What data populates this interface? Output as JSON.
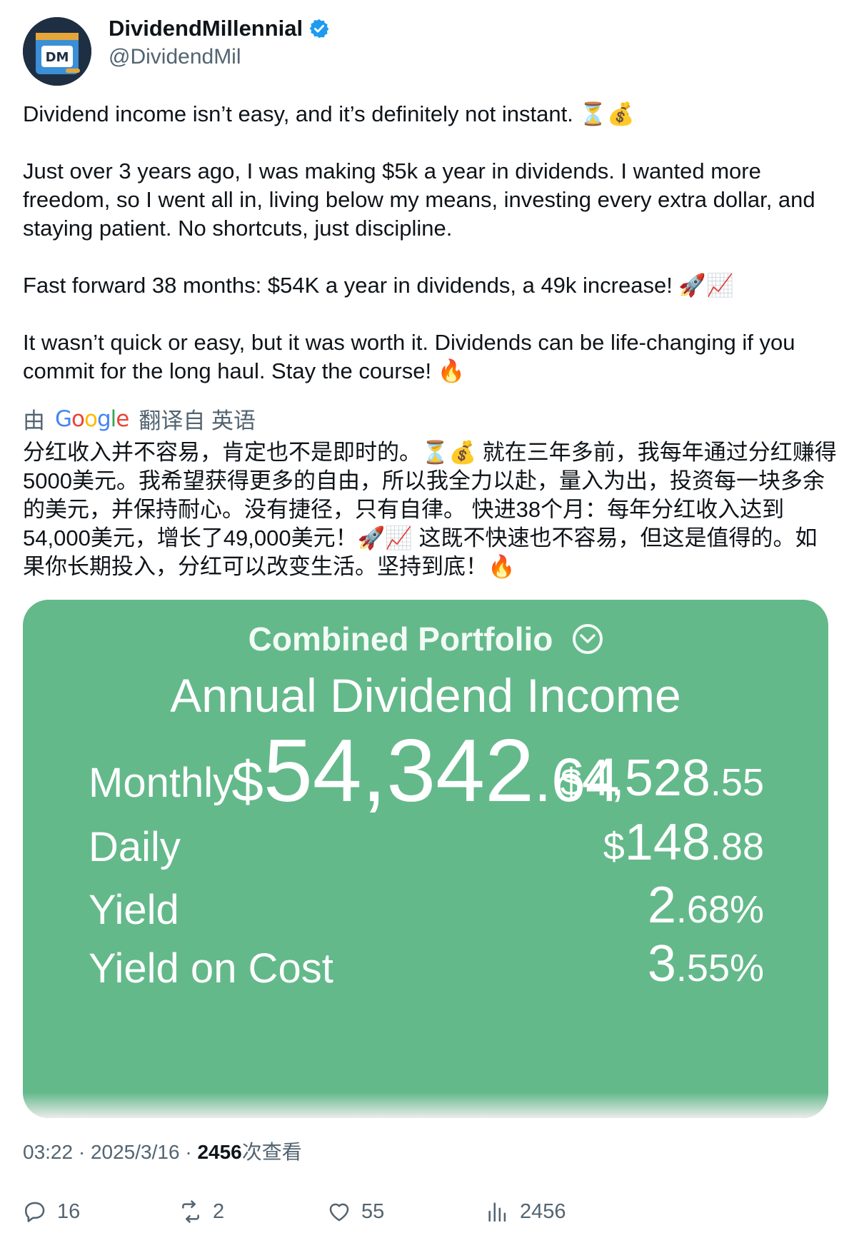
{
  "author": {
    "display_name": "DividendMillennial",
    "handle": "@DividendMil",
    "avatar_initials": "DM",
    "verified_color": "#1d9bf0"
  },
  "tweet": {
    "text": "Dividend income isn’t easy, and it’s definitely not instant. ⏳💰\n\nJust over 3 years ago, I was making $5k a year in dividends. I wanted more freedom, so I went all in, living below my means, investing every extra dollar, and staying patient. No shortcuts, just discipline.\n\nFast forward 38 months: $54K a year in dividends, a 49k increase! 🚀📈\n\nIt wasn’t quick or easy, but it was worth it. Dividends can be life-changing if you commit for the long haul. Stay the course! 🔥"
  },
  "translation": {
    "prefix": "由",
    "provider": "Google",
    "suffix": "翻译自 英语",
    "text": "分红收入并不容易，肯定也不是即时的。⏳💰 就在三年多前，我每年通过分红赚得5000美元。我希望获得更多的自由，所以我全力以赴，量入为出，投资每一块多余的美元，并保持耐心。没有捷径，只有自律。 快进38个月：每年分红收入达到54,000美元，增长了49,000美元！🚀📈 这既不快速也不容易，但这是值得的。如果你长期投入，分红可以改变生活。坚持到底！🔥"
  },
  "card": {
    "title": "Combined Portfolio",
    "subtitle": "Annual Dividend Income",
    "total": {
      "currency": "$",
      "main": "54,342",
      "cents": ".64"
    },
    "rows": [
      {
        "label": "Monthly",
        "prefix": "$",
        "main": "4,528",
        "sub": ".55"
      },
      {
        "label": "Daily",
        "prefix": "$",
        "main": "148",
        "sub": ".88"
      },
      {
        "label": "Yield",
        "prefix": "",
        "main": "2",
        "sub": ".68%"
      },
      {
        "label": "Yield on Cost",
        "prefix": "",
        "main": "3",
        "sub": ".55%"
      }
    ],
    "bg_color": "#63b98a"
  },
  "meta": {
    "time": "03:22",
    "sep1": " · ",
    "date": "2025/3/16",
    "sep2": " · ",
    "views": "2456",
    "views_label": "次查看"
  },
  "actions": {
    "replies": "16",
    "reposts": "2",
    "likes": "55",
    "views": "2456"
  }
}
